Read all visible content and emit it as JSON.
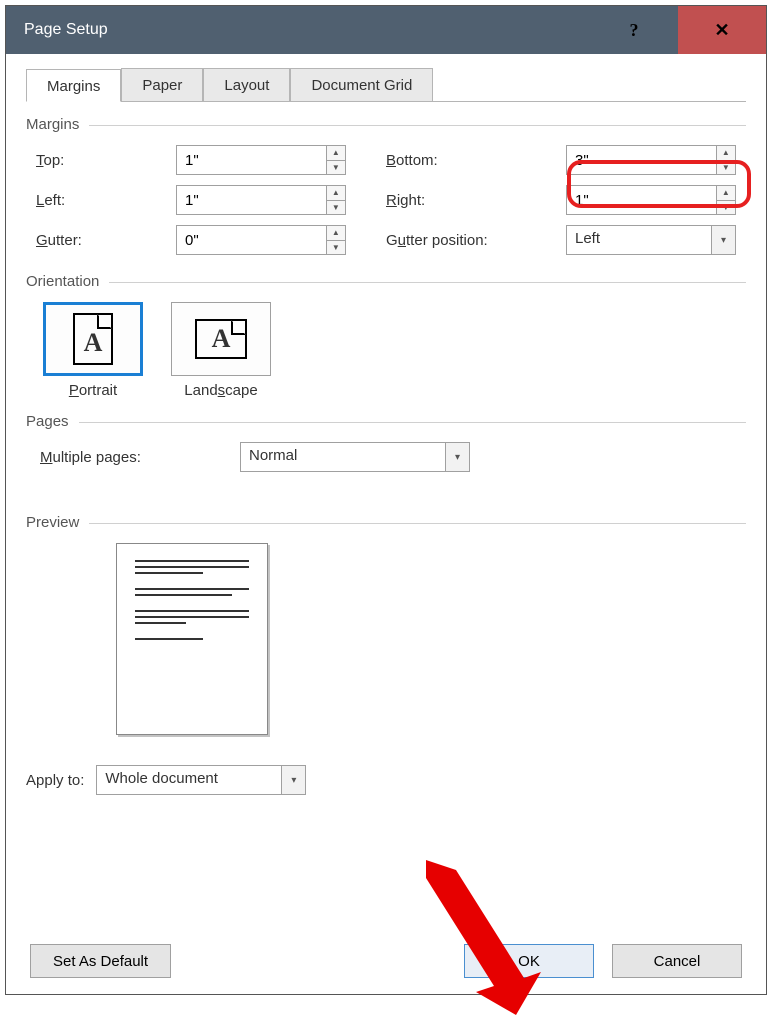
{
  "title": "Page Setup",
  "tabs": [
    "Margins",
    "Paper",
    "Layout",
    "Document Grid"
  ],
  "sections": {
    "margins": "Margins",
    "orientation": "Orientation",
    "pages": "Pages",
    "preview": "Preview"
  },
  "fields": {
    "top": {
      "label": "Top:",
      "accel": "T",
      "value": "1\""
    },
    "bottom": {
      "label": "Bottom:",
      "accel": "B",
      "value": "3\""
    },
    "left": {
      "label": "Left:",
      "accel": "L",
      "value": "1\""
    },
    "right": {
      "label": "Right:",
      "accel": "R",
      "value": "1\""
    },
    "gutter": {
      "label": "Gutter:",
      "accel": "G",
      "value": "0\""
    },
    "gutter_pos": {
      "label": "Gutter position:",
      "accel": "u",
      "value": "Left"
    }
  },
  "orientation": {
    "portrait": {
      "label": "Portrait",
      "accel": "P",
      "selected": true
    },
    "landscape": {
      "label": "Landscape",
      "accel": "s",
      "selected": false
    }
  },
  "pages": {
    "multiple_label": "Multiple pages:",
    "multiple_accel": "M",
    "multiple_value": "Normal"
  },
  "apply_to": {
    "label": "Apply to:",
    "value": "Whole document"
  },
  "buttons": {
    "set_default": "Set As Default",
    "ok": "OK",
    "cancel": "Cancel"
  }
}
